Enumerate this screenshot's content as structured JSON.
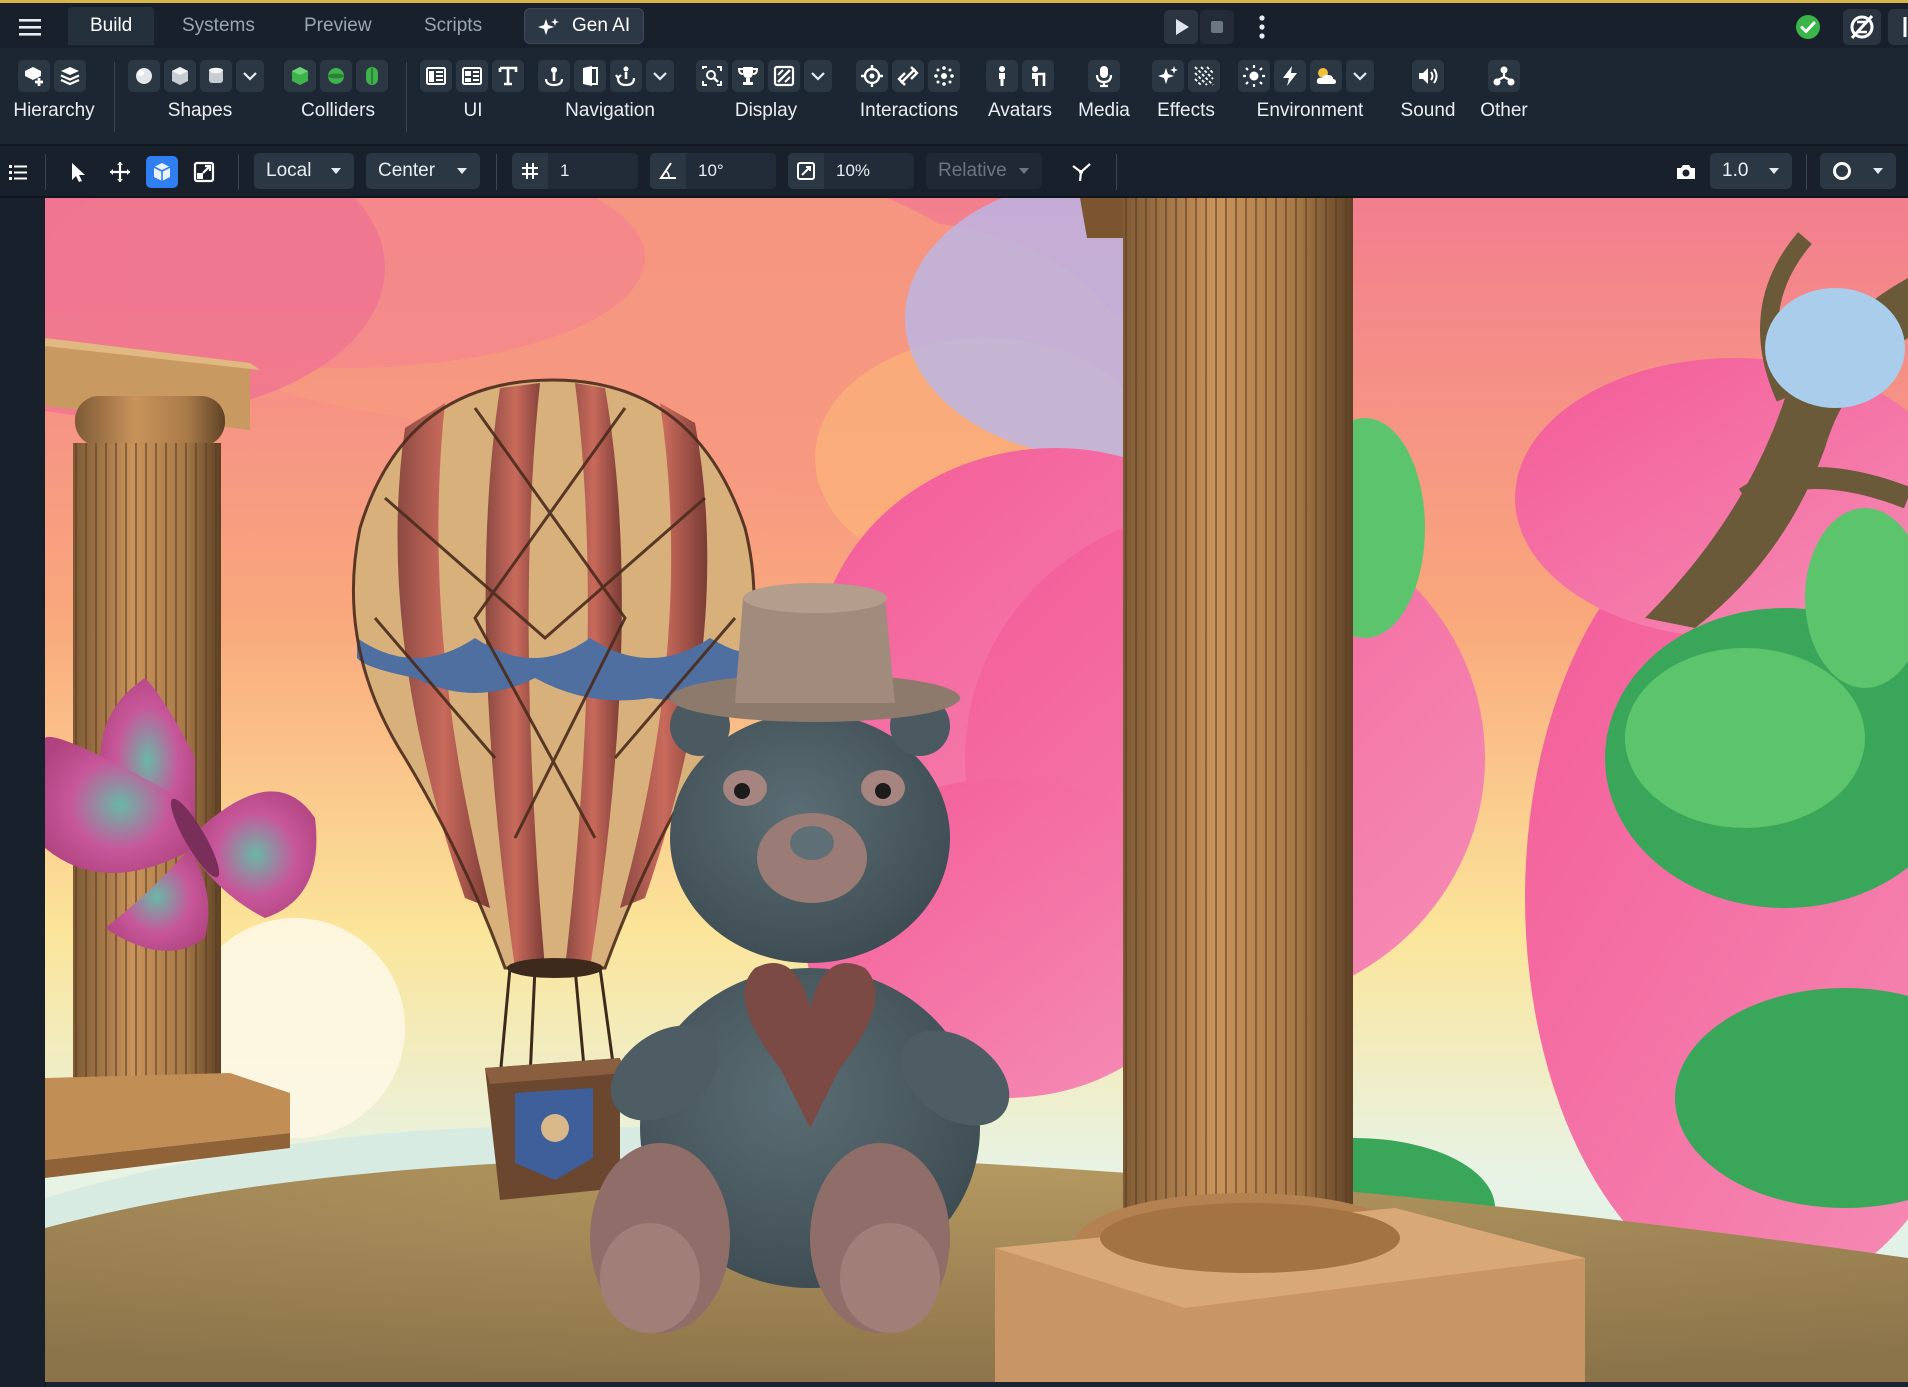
{
  "top_tabs": [
    {
      "label": "Build",
      "active": true
    },
    {
      "label": "Systems",
      "active": false
    },
    {
      "label": "Preview",
      "active": false
    },
    {
      "label": "Scripts",
      "active": false
    }
  ],
  "gen_ai": {
    "label": "Gen AI"
  },
  "ribbon": {
    "hierarchy": "Hierarchy",
    "shapes": "Shapes",
    "colliders": "Colliders",
    "ui": "UI",
    "navigation": "Navigation",
    "display": "Display",
    "interactions": "Interactions",
    "avatars": "Avatars",
    "media": "Media",
    "effects": "Effects",
    "environment": "Environment",
    "sound": "Sound",
    "other": "Other"
  },
  "toolbar": {
    "space": "Local",
    "pivot": "Center",
    "grid_snap": "1",
    "rotate_snap": "10°",
    "scale_snap": "10%",
    "snap_mode": "Relative",
    "camera_speed": "1.0"
  },
  "colors": {
    "accent": "#2f7ff0",
    "status_ok": "#3bb44a",
    "collider_green": "#3fb24b",
    "top_border": "#d8b64a"
  },
  "icons": {
    "menu": "hamburger-icon",
    "play": "play-icon",
    "stop": "stop-icon",
    "more": "kebab-icon",
    "status": "check-circle-icon",
    "nosync": "sync-off-icon"
  }
}
